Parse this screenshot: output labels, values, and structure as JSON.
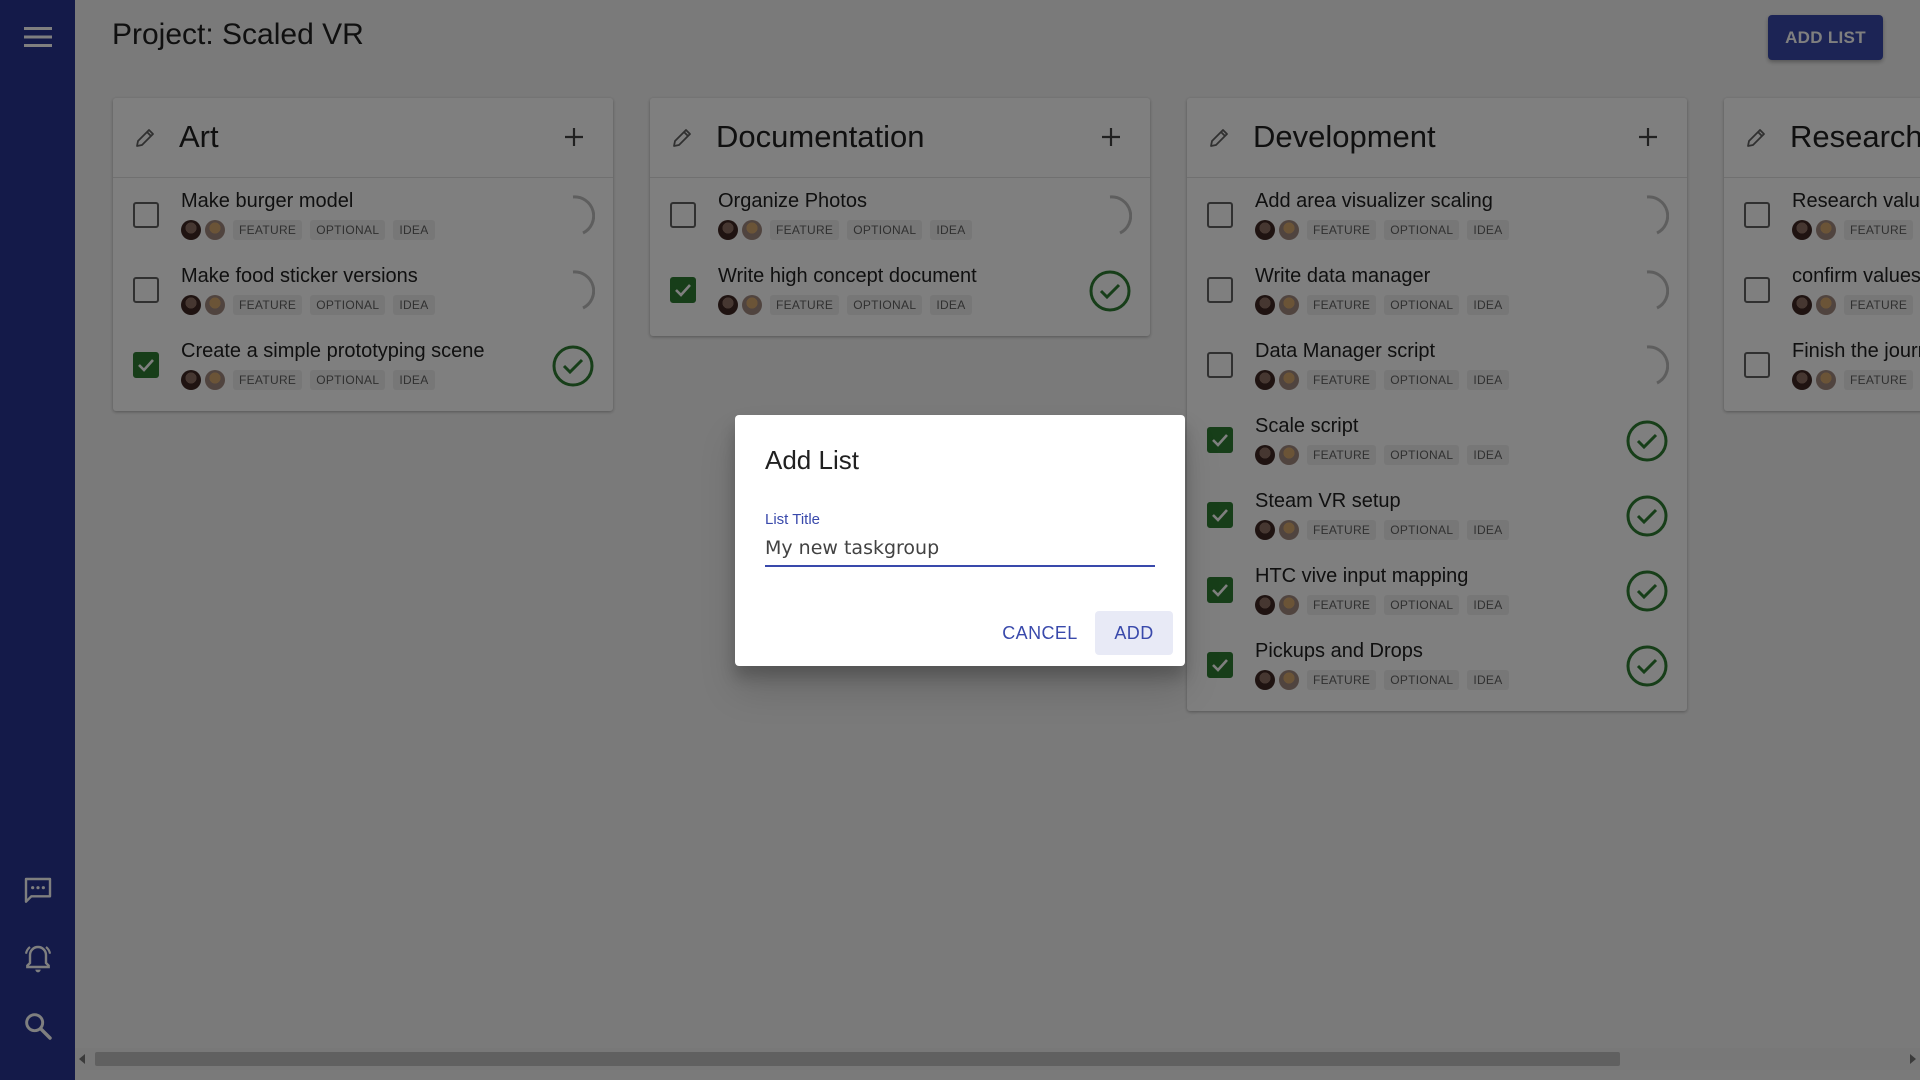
{
  "header": {
    "title": "Project: Scaled VR",
    "add_list_label": "ADD LIST"
  },
  "sidebar": {
    "menu_icon": "menu-icon",
    "chat_icon": "chat-icon",
    "bell_icon": "bell-icon",
    "search_icon": "search-icon"
  },
  "tags": [
    "FEATURE",
    "OPTIONAL",
    "IDEA"
  ],
  "columns": [
    {
      "title": "Art",
      "tasks": [
        {
          "title": "Make burger model",
          "done": false
        },
        {
          "title": "Make food sticker versions",
          "done": false
        },
        {
          "title": "Create a simple prototyping scene",
          "done": true
        }
      ]
    },
    {
      "title": "Documentation",
      "tasks": [
        {
          "title": "Organize Photos",
          "done": false
        },
        {
          "title": "Write high concept document",
          "done": true
        }
      ]
    },
    {
      "title": "Development",
      "tasks": [
        {
          "title": "Add area visualizer scaling",
          "done": false
        },
        {
          "title": "Write data manager",
          "done": false
        },
        {
          "title": "Data Manager script",
          "done": false
        },
        {
          "title": "Scale script",
          "done": true
        },
        {
          "title": "Steam VR setup",
          "done": true
        },
        {
          "title": "HTC vive input mapping",
          "done": true
        },
        {
          "title": "Pickups and Drops",
          "done": true
        }
      ]
    },
    {
      "title": "Research",
      "tasks": [
        {
          "title": "Research values",
          "done": false
        },
        {
          "title": "confirm values",
          "done": false
        },
        {
          "title": "Finish the journal",
          "done": false
        }
      ]
    }
  ],
  "dialog": {
    "title": "Add List",
    "field_label": "List Title",
    "field_value": "My new taskgroup",
    "cancel_label": "CANCEL",
    "add_label": "ADD"
  },
  "colors": {
    "sidebar": "#283593",
    "accent": "#3949ab",
    "done": "#2e7d32"
  }
}
